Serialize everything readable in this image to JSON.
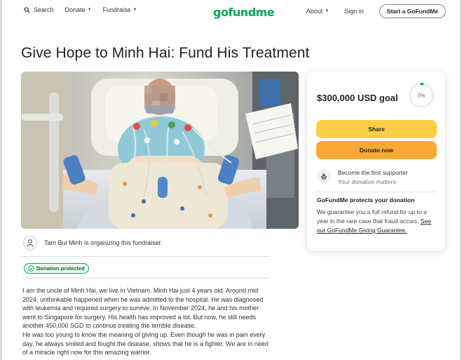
{
  "nav": {
    "search": "Search",
    "donate": "Donate",
    "fundraise": "Fundraise",
    "logo": "gofundme",
    "about": "About",
    "signin": "Sign in",
    "start": "Start a GoFundMe"
  },
  "page": {
    "title": "Give Hope to Minh Hai: Fund His Treatment"
  },
  "organizer": {
    "text": "Tam Bui Minh is organizing this fundraiser."
  },
  "badge": {
    "label": "Donation protected"
  },
  "story": {
    "paragraph1": "I am the uncle of Minh Hai, we live in Vietnam. Minh Hai just 4 years old. Around mid 2024, unthinkable happened when he was admitted to the hospital. He was diagnosed with leukemia and required surgery to survive. In November 2024, he and his mother went to Singapore for surgery. His health has improved a lot. But now, he still needs another 450,000 SGD to continue treating the terrible disease.",
    "paragraph2": "He was too young to know the meaning of giving up. Even though he was in pain every day, he always smiled and fought the disease, shows that he is a fighter. We are in need of a miracle right now for this amazing warrior."
  },
  "card": {
    "goal": "$300,000 USD goal",
    "percent": "0%",
    "progress_fraction": 0.0,
    "share": "Share",
    "donate": "Donate now",
    "supporter_title": "Become the first supporter",
    "supporter_sub": "Your donation matters",
    "protect_title": "GoFundMe protects your donation",
    "protect_text": "We guarantee you a full refund for up to a year in the rare case that fraud occurs.",
    "protect_link": "See our GoFundMe Giving Guarantee."
  },
  "colors": {
    "brand_green": "#02a95c",
    "share_yellow": "#fcce45",
    "donate_orange": "#f8a934"
  }
}
